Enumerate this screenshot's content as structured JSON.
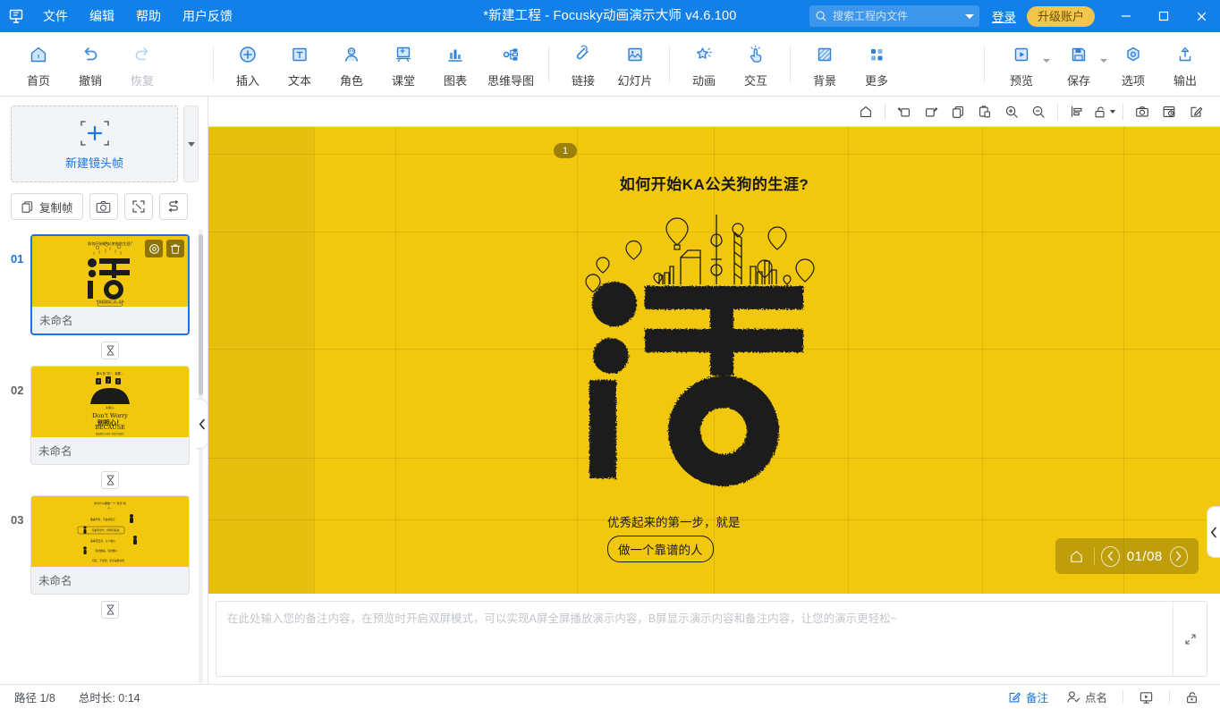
{
  "titlebar": {
    "logo_icon": "focusky-logo-icon",
    "menus": [
      {
        "label": "文件",
        "name": "menu-file"
      },
      {
        "label": "编辑",
        "name": "menu-edit"
      },
      {
        "label": "帮助",
        "name": "menu-help"
      },
      {
        "label": "用户反馈",
        "name": "menu-feedback"
      }
    ],
    "title": "*新建工程 - Focusky动画演示大师  v4.6.100",
    "search": {
      "value": "",
      "placeholder": "搜索工程内文件",
      "icon": "search-icon",
      "caret_icon": "chevron-down-icon"
    },
    "login_label": "登录",
    "upgrade_label": "升级账户",
    "window": {
      "minimize": "minimize-icon",
      "maximize": "maximize-icon",
      "close": "close-icon"
    },
    "bg_color": "#1180e8",
    "upgrade_color": "#f2c64a"
  },
  "ribbon": {
    "items": [
      {
        "label": "首页",
        "name": "ribbon-home",
        "icon": "home-icon",
        "disabled": false,
        "caret": false
      },
      {
        "label": "撤销",
        "name": "ribbon-undo",
        "icon": "undo-icon",
        "disabled": false,
        "caret": false
      },
      {
        "label": "恢复",
        "name": "ribbon-redo",
        "icon": "redo-icon",
        "disabled": true,
        "caret": false
      },
      {
        "label": "插入",
        "name": "ribbon-insert",
        "icon": "plus-circle-icon",
        "disabled": false,
        "caret": false
      },
      {
        "label": "文本",
        "name": "ribbon-text",
        "icon": "text-box-icon",
        "disabled": false,
        "caret": false
      },
      {
        "label": "角色",
        "name": "ribbon-role",
        "icon": "person-icon",
        "disabled": false,
        "caret": false
      },
      {
        "label": "课堂",
        "name": "ribbon-classroom",
        "icon": "classroom-icon",
        "disabled": false,
        "caret": false
      },
      {
        "label": "图表",
        "name": "ribbon-chart",
        "icon": "bar-chart-icon",
        "disabled": false,
        "caret": false
      },
      {
        "label": "思维导图",
        "name": "ribbon-mindmap",
        "icon": "mindmap-icon",
        "disabled": false,
        "caret": false
      },
      {
        "label": "链接",
        "name": "ribbon-link",
        "icon": "paperclip-icon",
        "disabled": false,
        "caret": false
      },
      {
        "label": "幻灯片",
        "name": "ribbon-slide",
        "icon": "slide-icon",
        "disabled": false,
        "caret": false
      },
      {
        "label": "动画",
        "name": "ribbon-animation",
        "icon": "star-wand-icon",
        "disabled": false,
        "caret": false
      },
      {
        "label": "交互",
        "name": "ribbon-interact",
        "icon": "hand-click-icon",
        "disabled": false,
        "caret": false
      },
      {
        "label": "背景",
        "name": "ribbon-background",
        "icon": "background-icon",
        "disabled": false,
        "caret": false
      },
      {
        "label": "更多",
        "name": "ribbon-more",
        "icon": "grid-dots-icon",
        "disabled": false,
        "caret": false
      },
      {
        "label": "预览",
        "name": "ribbon-preview",
        "icon": "play-box-icon",
        "disabled": false,
        "caret": true
      },
      {
        "label": "保存",
        "name": "ribbon-save",
        "icon": "floppy-icon",
        "disabled": false,
        "caret": true
      },
      {
        "label": "选项",
        "name": "ribbon-options",
        "icon": "options-gear-icon",
        "disabled": false,
        "caret": false
      },
      {
        "label": "输出",
        "name": "ribbon-export",
        "icon": "upload-icon",
        "disabled": false,
        "caret": false
      }
    ]
  },
  "left_panel": {
    "new_frame_label": "新建镜头帧",
    "new_frame_icon": "add-frame-icon",
    "new_frame_dropdown_icon": "chevron-down-icon",
    "tools": [
      {
        "label": "复制帧",
        "name": "duplicate-frame-button",
        "icon": "copy-icon"
      },
      {
        "label": "",
        "name": "capture-frame-button",
        "icon": "camera-icon"
      },
      {
        "label": "",
        "name": "fit-frame-button",
        "icon": "expand-corners-icon"
      },
      {
        "label": "",
        "name": "reorder-frames-button",
        "icon": "swap-path-icon"
      }
    ],
    "timing_icon": "hourglass-icon",
    "frames": [
      {
        "number": "01",
        "name": "未命名",
        "selected": true,
        "thumb_type": "huo"
      },
      {
        "number": "02",
        "name": "未命名",
        "selected": false,
        "thumb_type": "crowd"
      },
      {
        "number": "03",
        "name": "未命名",
        "selected": false,
        "thumb_type": "list"
      }
    ],
    "frame_badges": [
      {
        "name": "frame-settings-button",
        "icon": "target-icon"
      },
      {
        "name": "frame-delete-button",
        "icon": "trash-icon"
      }
    ],
    "collapse_icon": "chevron-left-icon"
  },
  "canvas_toolbar": {
    "buttons": [
      {
        "name": "canvas-home-button",
        "icon": "home-outline-icon",
        "caret": false
      },
      {
        "name": "canvas-rotate-left-button",
        "icon": "rotate-left-icon",
        "caret": false
      },
      {
        "name": "canvas-rotate-right-button",
        "icon": "rotate-right-icon",
        "caret": false
      },
      {
        "name": "canvas-copy-button",
        "icon": "copy-outline-icon",
        "caret": false
      },
      {
        "name": "canvas-paste-button",
        "icon": "paste-icon",
        "caret": false
      },
      {
        "name": "canvas-zoom-in-button",
        "icon": "zoom-in-icon",
        "caret": false
      },
      {
        "name": "canvas-zoom-out-button",
        "icon": "zoom-out-icon",
        "caret": false
      },
      {
        "name": "canvas-align-button",
        "icon": "align-left-icon",
        "caret": false
      },
      {
        "name": "canvas-lock-button",
        "icon": "unlock-icon",
        "caret": true
      },
      {
        "name": "canvas-screenshot-button",
        "icon": "camera-outline-icon",
        "caret": false
      },
      {
        "name": "canvas-history-button",
        "icon": "history-icon",
        "caret": false
      },
      {
        "name": "canvas-edit-button",
        "icon": "edit-square-icon",
        "caret": false
      }
    ]
  },
  "stage": {
    "background_color": "#f2c80f",
    "slide_badge": "1",
    "title": "如何开始KA公关狗的生涯?",
    "subtitle": "优秀起来的第一步，就是",
    "chip": "做一个靠谱的人",
    "artwork_name": "huo-character-skyline-artwork",
    "nav": {
      "home_icon": "home-outline-icon",
      "prev_icon": "chevron-left-icon",
      "next_icon": "chevron-right-icon",
      "counter": "01/08"
    },
    "collapse_icon": "chevron-left-icon"
  },
  "notes": {
    "value": "",
    "placeholder": "在此处输入您的备注内容，在预览时开启双屏模式，可以实现A屏全屏播放演示内容，B屏显示演示内容和备注内容，让您的演示更轻松~",
    "expand_icon": "expand-diagonal-icon"
  },
  "statusbar": {
    "path_label": "路径 1/8",
    "duration_label": "总时长: 0:14",
    "right_buttons": [
      {
        "label": "备注",
        "name": "status-notes-button",
        "icon": "note-edit-icon",
        "active": true
      },
      {
        "label": "点名",
        "name": "status-rollcall-button",
        "icon": "person-check-icon",
        "active": false
      },
      {
        "label": "",
        "name": "status-presenter-button",
        "icon": "presenter-screen-icon",
        "active": false
      },
      {
        "label": "",
        "name": "status-lock-button",
        "icon": "lock-icon",
        "active": false
      }
    ],
    "accent_color": "#1a73e8"
  }
}
